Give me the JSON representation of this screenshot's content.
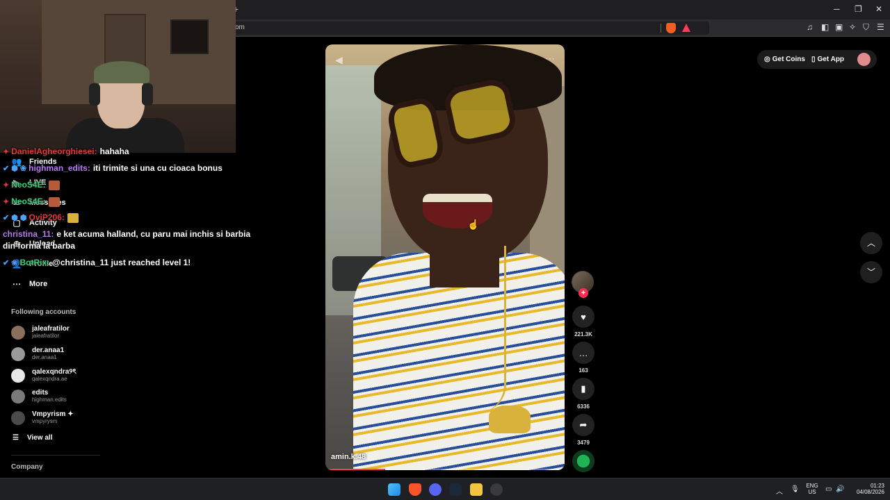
{
  "browser": {
    "url_fragment": "om",
    "new_tab_glyph": "+",
    "window_controls": {
      "minimize": "─",
      "restore": "❐",
      "close": "✕"
    },
    "toolbar_icons": [
      "music-icon",
      "sidebar-icon",
      "wallet-icon",
      "leo-ai-icon",
      "vpn-shield-icon",
      "menu-icon"
    ]
  },
  "sidebar": {
    "nav": [
      {
        "label": "Friends",
        "icon": "friends-icon",
        "glyph": "👥"
      },
      {
        "label": "LIVE",
        "icon": "live-icon",
        "glyph": "▶"
      },
      {
        "label": "Messages",
        "icon": "messages-icon",
        "glyph": "✉"
      },
      {
        "label": "Activity",
        "icon": "activity-icon",
        "glyph": "▢"
      },
      {
        "label": "Upload",
        "icon": "upload-icon",
        "glyph": "⊕"
      },
      {
        "label": "Profile",
        "icon": "profile-icon",
        "glyph": "👤"
      },
      {
        "label": "More",
        "icon": "more-icon",
        "glyph": "⋯"
      }
    ],
    "following_title": "Following accounts",
    "accounts": [
      {
        "name": "jaleafratilor",
        "handle": "jaleafratilor"
      },
      {
        "name": "der.anaa1",
        "handle": "der.anaa1"
      },
      {
        "name": "qalexqndra୨ৎ",
        "handle": "qalexqndra.ae"
      },
      {
        "name": "edits",
        "handle": "highman.edits"
      },
      {
        "name": "Vmpyrism ✦",
        "handle": "vmpyrysm"
      }
    ],
    "view_all": "View all",
    "company": "Company"
  },
  "chat": {
    "lines": [
      {
        "user": "DanielAgheorghiesei:",
        "color": "#e03a3a",
        "badges": "✦",
        "text": "hahaha"
      },
      {
        "user": "highman_edits:",
        "color": "#b67cf0",
        "badges": "✔ ⬢ ❀",
        "text": "iti trimite si una cu cioaca bonus"
      },
      {
        "user": "NeoS4E:",
        "color": "#3bd17a",
        "badges": "✦",
        "text": ""
      },
      {
        "user": "NeoS4E:",
        "color": "#3bd17a",
        "badges": "✦",
        "text": ""
      },
      {
        "user": "OviP206:",
        "color": "#e03a3a",
        "badges": "✔ ⬢ ⬢",
        "text": ""
      },
      {
        "user": "christina_11:",
        "color": "#b67cf0",
        "badges": "",
        "text": "e ket acuma halland, cu paru mai inchis si barbia"
      },
      {
        "user": "",
        "color": "#fff",
        "badges": "",
        "text": "din forma la barba"
      },
      {
        "user": "BotRix:",
        "color": "#3bd17a",
        "badges": "✔ ❀",
        "text": "@christina_11 just reached level 1!"
      }
    ]
  },
  "video": {
    "author": "amin.k.48",
    "progress": 0.25,
    "mute_glyph": "◀",
    "more_glyph": "⋯",
    "cursor_glyph": "☝"
  },
  "actions": {
    "follow_glyph": "+",
    "like_glyph": "♥",
    "likes": "221.3K",
    "comment_glyph": "…",
    "comments": "163",
    "save_glyph": "▮",
    "saves": "6336",
    "share_glyph": "➦",
    "shares": "3479"
  },
  "header": {
    "get_coins": "Get Coins",
    "get_coins_glyph": "◎",
    "get_app": "Get App",
    "get_app_glyph": "▯"
  },
  "navigation": {
    "up_glyph": "︿",
    "down_glyph": "﹀"
  },
  "taskbar": {
    "lang_top": "ENG",
    "lang_bottom": "US",
    "time": "01:23",
    "date": "04/08/2026",
    "tray_chevron": "︿",
    "mic_glyph": "🎙",
    "display_glyph": "▭",
    "volume_glyph": "🔊"
  }
}
